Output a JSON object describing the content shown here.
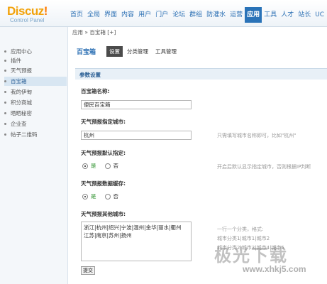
{
  "header": {
    "logo": "Discuz",
    "logo_mark": "!",
    "subtitle": "Control Panel",
    "nav": [
      "首页",
      "全局",
      "界面",
      "内容",
      "用户",
      "门户",
      "论坛",
      "群组",
      "防灌水",
      "运营",
      "应用",
      "工具",
      "人才",
      "站长",
      "UC"
    ],
    "active_nav": "应用"
  },
  "sidebar": {
    "items": [
      "应用中心",
      "插件",
      "天气预报",
      "百宝箱",
      "我的伊甸",
      "积分商城",
      "晒晒秘密",
      "企业查",
      "帖子二维码"
    ],
    "active_index": 3
  },
  "breadcrumb": "应用 » 百宝箱 [+]",
  "main": {
    "title": "百宝箱",
    "tabs": [
      "设置",
      "分类管理",
      "工具管理"
    ],
    "section_title": "参数设置",
    "fields": {
      "name_label": "百宝箱名称:",
      "name_value": "便民百宝箱",
      "city_label": "天气预报指定城市:",
      "city_value": "杭州",
      "city_hint": "只需填写城市名称即可，比如\"杭州\"",
      "default_label": "天气预报默认指定:",
      "default_hint": "开启后默认显示指定城市，否则根据IP判断",
      "cache_label": "天气预报数据缓存:",
      "yes": "是",
      "no": "否",
      "other_label": "天气预报其他城市:",
      "other_value": "浙江|杭州|绍兴|宁波|温州|金华|丽水|衢州\n江苏|南京|苏州|扬州",
      "other_hint_1": "一行一个分类，格式:",
      "other_hint_2": "城市分类1|城市1|城市2",
      "other_hint_3": "城市分类2|城市3|城市4|城市5"
    },
    "submit_label": "提交"
  },
  "watermark": {
    "text": "极光下载",
    "url": "www.xhkj5.com"
  }
}
